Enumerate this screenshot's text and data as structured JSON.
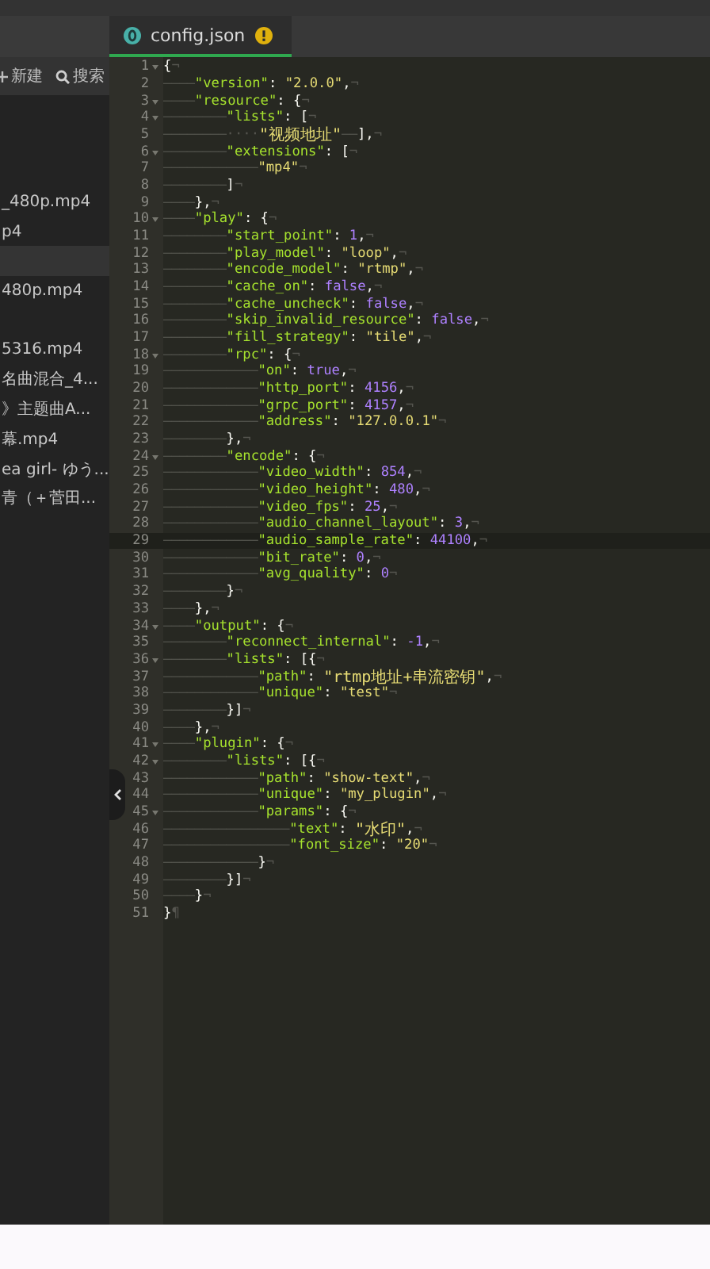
{
  "sidebar": {
    "toolbar": [
      {
        "kind": "new",
        "label": "新建"
      },
      {
        "kind": "search",
        "label": "搜索"
      }
    ],
    "files": [
      {
        "label": "_480p.mp4",
        "selected": false
      },
      {
        "label": "p4",
        "selected": false
      },
      {
        "selected": true
      },
      {
        "label": "480p.mp4",
        "selected": false
      },
      {
        "label": "5316.mp4",
        "selected": false
      },
      {
        "label": "名曲混合_4...",
        "selected": false
      },
      {
        "label": "》主题曲A...",
        "selected": false
      },
      {
        "label": "幕.mp4",
        "selected": false
      },
      {
        "label": "ea girl- ゆう...",
        "selected": false
      },
      {
        "label": "青（＋菅田...",
        "selected": false
      }
    ]
  },
  "tabs": [
    {
      "label": "config.json",
      "selected": true,
      "warning": true
    }
  ],
  "editor": {
    "lines": [
      {
        "n": "1",
        "fold": true,
        "current": false,
        "tokens": [
          {
            "kind": "punct",
            "text": "{"
          },
          {
            "kind": "eol",
            "text": "¬"
          }
        ]
      },
      {
        "n": "2",
        "fold": false,
        "current": false,
        "indent": "————",
        "tokens": [
          {
            "kind": "key",
            "text": "\"version\""
          },
          {
            "kind": "punct",
            "text": ": "
          },
          {
            "kind": "str",
            "text": "\"2.0.0\""
          },
          {
            "kind": "punct",
            "text": ","
          },
          {
            "kind": "eol",
            "text": "¬"
          }
        ]
      },
      {
        "n": "3",
        "fold": true,
        "current": false,
        "indent": "————",
        "tokens": [
          {
            "kind": "key",
            "text": "\"resource\""
          },
          {
            "kind": "punct",
            "text": ": {"
          },
          {
            "kind": "eol",
            "text": "¬"
          }
        ]
      },
      {
        "n": "4",
        "fold": true,
        "current": false,
        "indent": "————————",
        "tokens": [
          {
            "kind": "key",
            "text": "\"lists\""
          },
          {
            "kind": "punct",
            "text": ": ["
          },
          {
            "kind": "eol",
            "text": "¬"
          }
        ]
      },
      {
        "n": "5",
        "fold": false,
        "current": false,
        "indent": "————————",
        "tokens": [
          {
            "kind": "space",
            "text": "····"
          },
          {
            "kind": "str",
            "text": "\"视频地址\""
          },
          {
            "kind": "tab",
            "text": "——"
          },
          {
            "kind": "punct",
            "text": "],"
          },
          {
            "kind": "eol",
            "text": "¬"
          }
        ]
      },
      {
        "n": "6",
        "fold": true,
        "current": false,
        "indent": "————————",
        "tokens": [
          {
            "kind": "key",
            "text": "\"extensions\""
          },
          {
            "kind": "punct",
            "text": ": ["
          },
          {
            "kind": "eol",
            "text": "¬"
          }
        ]
      },
      {
        "n": "7",
        "fold": false,
        "current": false,
        "indent": "————————————",
        "tokens": [
          {
            "kind": "str",
            "text": "\"mp4\""
          },
          {
            "kind": "eol",
            "text": "¬"
          }
        ]
      },
      {
        "n": "8",
        "fold": false,
        "current": false,
        "indent": "————————",
        "tokens": [
          {
            "kind": "punct",
            "text": "]"
          },
          {
            "kind": "eol",
            "text": "¬"
          }
        ]
      },
      {
        "n": "9",
        "fold": false,
        "current": false,
        "indent": "————",
        "tokens": [
          {
            "kind": "punct",
            "text": "},"
          },
          {
            "kind": "eol",
            "text": "¬"
          }
        ]
      },
      {
        "n": "10",
        "fold": true,
        "current": false,
        "indent": "————",
        "tokens": [
          {
            "kind": "key",
            "text": "\"play\""
          },
          {
            "kind": "punct",
            "text": ": {"
          },
          {
            "kind": "eol",
            "text": "¬"
          }
        ]
      },
      {
        "n": "11",
        "fold": false,
        "current": false,
        "indent": "————————",
        "tokens": [
          {
            "kind": "key",
            "text": "\"start_point\""
          },
          {
            "kind": "punct",
            "text": ": "
          },
          {
            "kind": "num",
            "text": "1"
          },
          {
            "kind": "punct",
            "text": ","
          },
          {
            "kind": "eol",
            "text": "¬"
          }
        ]
      },
      {
        "n": "12",
        "fold": false,
        "current": false,
        "indent": "————————",
        "tokens": [
          {
            "kind": "key",
            "text": "\"play_model\""
          },
          {
            "kind": "punct",
            "text": ": "
          },
          {
            "kind": "str",
            "text": "\"loop\""
          },
          {
            "kind": "punct",
            "text": ","
          },
          {
            "kind": "eol",
            "text": "¬"
          }
        ]
      },
      {
        "n": "13",
        "fold": false,
        "current": false,
        "indent": "————————",
        "tokens": [
          {
            "kind": "key",
            "text": "\"encode_model\""
          },
          {
            "kind": "punct",
            "text": ": "
          },
          {
            "kind": "str",
            "text": "\"rtmp\""
          },
          {
            "kind": "punct",
            "text": ","
          },
          {
            "kind": "eol",
            "text": "¬"
          }
        ]
      },
      {
        "n": "14",
        "fold": false,
        "current": false,
        "indent": "————————",
        "tokens": [
          {
            "kind": "key",
            "text": "\"cache_on\""
          },
          {
            "kind": "punct",
            "text": ": "
          },
          {
            "kind": "num",
            "text": "false"
          },
          {
            "kind": "punct",
            "text": ","
          },
          {
            "kind": "eol",
            "text": "¬"
          }
        ]
      },
      {
        "n": "15",
        "fold": false,
        "current": false,
        "indent": "————————",
        "tokens": [
          {
            "kind": "key",
            "text": "\"cache_uncheck\""
          },
          {
            "kind": "punct",
            "text": ": "
          },
          {
            "kind": "num",
            "text": "false"
          },
          {
            "kind": "punct",
            "text": ","
          },
          {
            "kind": "eol",
            "text": "¬"
          }
        ]
      },
      {
        "n": "16",
        "fold": false,
        "current": false,
        "indent": "————————",
        "tokens": [
          {
            "kind": "key",
            "text": "\"skip_invalid_resource\""
          },
          {
            "kind": "punct",
            "text": ": "
          },
          {
            "kind": "num",
            "text": "false"
          },
          {
            "kind": "punct",
            "text": ","
          },
          {
            "kind": "eol",
            "text": "¬"
          }
        ]
      },
      {
        "n": "17",
        "fold": false,
        "current": false,
        "indent": "————————",
        "tokens": [
          {
            "kind": "key",
            "text": "\"fill_strategy\""
          },
          {
            "kind": "punct",
            "text": ": "
          },
          {
            "kind": "str",
            "text": "\"tile\""
          },
          {
            "kind": "punct",
            "text": ","
          },
          {
            "kind": "eol",
            "text": "¬"
          }
        ]
      },
      {
        "n": "18",
        "fold": true,
        "current": false,
        "indent": "————————",
        "tokens": [
          {
            "kind": "key",
            "text": "\"rpc\""
          },
          {
            "kind": "punct",
            "text": ": {"
          },
          {
            "kind": "eol",
            "text": "¬"
          }
        ]
      },
      {
        "n": "19",
        "fold": false,
        "current": false,
        "indent": "————————————",
        "tokens": [
          {
            "kind": "key",
            "text": "\"on\""
          },
          {
            "kind": "punct",
            "text": ": "
          },
          {
            "kind": "num",
            "text": "true"
          },
          {
            "kind": "punct",
            "text": ","
          },
          {
            "kind": "eol",
            "text": "¬"
          }
        ]
      },
      {
        "n": "20",
        "fold": false,
        "current": false,
        "indent": "————————————",
        "tokens": [
          {
            "kind": "key",
            "text": "\"http_port\""
          },
          {
            "kind": "punct",
            "text": ": "
          },
          {
            "kind": "num",
            "text": "4156"
          },
          {
            "kind": "punct",
            "text": ","
          },
          {
            "kind": "eol",
            "text": "¬"
          }
        ]
      },
      {
        "n": "21",
        "fold": false,
        "current": false,
        "indent": "————————————",
        "tokens": [
          {
            "kind": "key",
            "text": "\"grpc_port\""
          },
          {
            "kind": "punct",
            "text": ": "
          },
          {
            "kind": "num",
            "text": "4157"
          },
          {
            "kind": "punct",
            "text": ","
          },
          {
            "kind": "eol",
            "text": "¬"
          }
        ]
      },
      {
        "n": "22",
        "fold": false,
        "current": false,
        "indent": "————————————",
        "tokens": [
          {
            "kind": "key",
            "text": "\"address\""
          },
          {
            "kind": "punct",
            "text": ": "
          },
          {
            "kind": "str",
            "text": "\"127.0.0.1\""
          },
          {
            "kind": "eol",
            "text": "¬"
          }
        ]
      },
      {
        "n": "23",
        "fold": false,
        "current": false,
        "indent": "————————",
        "tokens": [
          {
            "kind": "punct",
            "text": "},"
          },
          {
            "kind": "eol",
            "text": "¬"
          }
        ]
      },
      {
        "n": "24",
        "fold": true,
        "current": false,
        "indent": "————————",
        "tokens": [
          {
            "kind": "key",
            "text": "\"encode\""
          },
          {
            "kind": "punct",
            "text": ": {"
          },
          {
            "kind": "eol",
            "text": "¬"
          }
        ]
      },
      {
        "n": "25",
        "fold": false,
        "current": false,
        "indent": "————————————",
        "tokens": [
          {
            "kind": "key",
            "text": "\"video_width\""
          },
          {
            "kind": "punct",
            "text": ": "
          },
          {
            "kind": "num",
            "text": "854"
          },
          {
            "kind": "punct",
            "text": ","
          },
          {
            "kind": "eol",
            "text": "¬"
          }
        ]
      },
      {
        "n": "26",
        "fold": false,
        "current": false,
        "indent": "————————————",
        "tokens": [
          {
            "kind": "key",
            "text": "\"video_height\""
          },
          {
            "kind": "punct",
            "text": ": "
          },
          {
            "kind": "num",
            "text": "480"
          },
          {
            "kind": "punct",
            "text": ","
          },
          {
            "kind": "eol",
            "text": "¬"
          }
        ]
      },
      {
        "n": "27",
        "fold": false,
        "current": false,
        "indent": "————————————",
        "tokens": [
          {
            "kind": "key",
            "text": "\"video_fps\""
          },
          {
            "kind": "punct",
            "text": ": "
          },
          {
            "kind": "num",
            "text": "25"
          },
          {
            "kind": "punct",
            "text": ","
          },
          {
            "kind": "eol",
            "text": "¬"
          }
        ]
      },
      {
        "n": "28",
        "fold": false,
        "current": false,
        "indent": "————————————",
        "tokens": [
          {
            "kind": "key",
            "text": "\"audio_channel_layout\""
          },
          {
            "kind": "punct",
            "text": ": "
          },
          {
            "kind": "num",
            "text": "3"
          },
          {
            "kind": "punct",
            "text": ","
          },
          {
            "kind": "eol",
            "text": "¬"
          }
        ]
      },
      {
        "n": "29",
        "fold": false,
        "current": true,
        "indent": "————————————",
        "tokens": [
          {
            "kind": "key",
            "text": "\"audio_sample_rate\""
          },
          {
            "kind": "punct",
            "text": ": "
          },
          {
            "kind": "num",
            "text": "44100"
          },
          {
            "kind": "punct",
            "text": ","
          },
          {
            "kind": "eol",
            "text": "¬"
          }
        ]
      },
      {
        "n": "30",
        "fold": false,
        "current": false,
        "indent": "————————————",
        "tokens": [
          {
            "kind": "key",
            "text": "\"bit_rate\""
          },
          {
            "kind": "punct",
            "text": ": "
          },
          {
            "kind": "num",
            "text": "0"
          },
          {
            "kind": "punct",
            "text": ","
          },
          {
            "kind": "eol",
            "text": "¬"
          }
        ]
      },
      {
        "n": "31",
        "fold": false,
        "current": false,
        "indent": "————————————",
        "tokens": [
          {
            "kind": "key",
            "text": "\"avg_quality\""
          },
          {
            "kind": "punct",
            "text": ": "
          },
          {
            "kind": "num",
            "text": "0"
          },
          {
            "kind": "eol",
            "text": "¬"
          }
        ]
      },
      {
        "n": "32",
        "fold": false,
        "current": false,
        "indent": "————————",
        "tokens": [
          {
            "kind": "punct",
            "text": "}"
          },
          {
            "kind": "eol",
            "text": "¬"
          }
        ]
      },
      {
        "n": "33",
        "fold": false,
        "current": false,
        "indent": "————",
        "tokens": [
          {
            "kind": "punct",
            "text": "},"
          },
          {
            "kind": "eol",
            "text": "¬"
          }
        ]
      },
      {
        "n": "34",
        "fold": true,
        "current": false,
        "indent": "————",
        "tokens": [
          {
            "kind": "key",
            "text": "\"output\""
          },
          {
            "kind": "punct",
            "text": ": {"
          },
          {
            "kind": "eol",
            "text": "¬"
          }
        ]
      },
      {
        "n": "35",
        "fold": false,
        "current": false,
        "indent": "————————",
        "tokens": [
          {
            "kind": "key",
            "text": "\"reconnect_internal\""
          },
          {
            "kind": "punct",
            "text": ": "
          },
          {
            "kind": "num",
            "text": "-1"
          },
          {
            "kind": "punct",
            "text": ","
          },
          {
            "kind": "eol",
            "text": "¬"
          }
        ]
      },
      {
        "n": "36",
        "fold": true,
        "current": false,
        "indent": "————————",
        "tokens": [
          {
            "kind": "key",
            "text": "\"lists\""
          },
          {
            "kind": "punct",
            "text": ": [{"
          },
          {
            "kind": "eol",
            "text": "¬"
          }
        ]
      },
      {
        "n": "37",
        "fold": false,
        "current": false,
        "indent": "————————————",
        "tokens": [
          {
            "kind": "key",
            "text": "\"path\""
          },
          {
            "kind": "punct",
            "text": ": "
          },
          {
            "kind": "str",
            "text": "\"rtmp地址+串流密钥\""
          },
          {
            "kind": "punct",
            "text": ","
          },
          {
            "kind": "eol",
            "text": "¬"
          }
        ]
      },
      {
        "n": "38",
        "fold": false,
        "current": false,
        "indent": "————————————",
        "tokens": [
          {
            "kind": "key",
            "text": "\"unique\""
          },
          {
            "kind": "punct",
            "text": ": "
          },
          {
            "kind": "str",
            "text": "\"test\""
          },
          {
            "kind": "eol",
            "text": "¬"
          }
        ]
      },
      {
        "n": "39",
        "fold": false,
        "current": false,
        "indent": "————————",
        "tokens": [
          {
            "kind": "punct",
            "text": "}]"
          },
          {
            "kind": "eol",
            "text": "¬"
          }
        ]
      },
      {
        "n": "40",
        "fold": false,
        "current": false,
        "indent": "————",
        "tokens": [
          {
            "kind": "punct",
            "text": "},"
          },
          {
            "kind": "eol",
            "text": "¬"
          }
        ]
      },
      {
        "n": "41",
        "fold": true,
        "current": false,
        "indent": "————",
        "tokens": [
          {
            "kind": "key",
            "text": "\"plugin\""
          },
          {
            "kind": "punct",
            "text": ": {"
          },
          {
            "kind": "eol",
            "text": "¬"
          }
        ]
      },
      {
        "n": "42",
        "fold": true,
        "current": false,
        "indent": "————————",
        "tokens": [
          {
            "kind": "key",
            "text": "\"lists\""
          },
          {
            "kind": "punct",
            "text": ": [{"
          },
          {
            "kind": "eol",
            "text": "¬"
          }
        ]
      },
      {
        "n": "43",
        "fold": false,
        "current": false,
        "indent": "————————————",
        "tokens": [
          {
            "kind": "key",
            "text": "\"path\""
          },
          {
            "kind": "punct",
            "text": ": "
          },
          {
            "kind": "str",
            "text": "\"show-text\""
          },
          {
            "kind": "punct",
            "text": ","
          },
          {
            "kind": "eol",
            "text": "¬"
          }
        ]
      },
      {
        "n": "44",
        "fold": false,
        "current": false,
        "indent": "————————————",
        "tokens": [
          {
            "kind": "key",
            "text": "\"unique\""
          },
          {
            "kind": "punct",
            "text": ": "
          },
          {
            "kind": "str",
            "text": "\"my_plugin\""
          },
          {
            "kind": "punct",
            "text": ","
          },
          {
            "kind": "eol",
            "text": "¬"
          }
        ]
      },
      {
        "n": "45",
        "fold": true,
        "current": false,
        "indent": "————————————",
        "tokens": [
          {
            "kind": "key",
            "text": "\"params\""
          },
          {
            "kind": "punct",
            "text": ": {"
          },
          {
            "kind": "eol",
            "text": "¬"
          }
        ]
      },
      {
        "n": "46",
        "fold": false,
        "current": false,
        "indent": "————————————————",
        "tokens": [
          {
            "kind": "key",
            "text": "\"text\""
          },
          {
            "kind": "punct",
            "text": ": "
          },
          {
            "kind": "str",
            "text": "\"水印\""
          },
          {
            "kind": "punct",
            "text": ","
          },
          {
            "kind": "eol",
            "text": "¬"
          }
        ]
      },
      {
        "n": "47",
        "fold": false,
        "current": false,
        "indent": "————————————————",
        "tokens": [
          {
            "kind": "key",
            "text": "\"font_size\""
          },
          {
            "kind": "punct",
            "text": ": "
          },
          {
            "kind": "str",
            "text": "\"20\""
          },
          {
            "kind": "eol",
            "text": "¬"
          }
        ]
      },
      {
        "n": "48",
        "fold": false,
        "current": false,
        "indent": "————————————",
        "tokens": [
          {
            "kind": "punct",
            "text": "}"
          },
          {
            "kind": "eol",
            "text": "¬"
          }
        ]
      },
      {
        "n": "49",
        "fold": false,
        "current": false,
        "indent": "————————",
        "tokens": [
          {
            "kind": "punct",
            "text": "}]"
          },
          {
            "kind": "eol",
            "text": "¬"
          }
        ]
      },
      {
        "n": "50",
        "fold": false,
        "current": false,
        "indent": "————",
        "tokens": [
          {
            "kind": "punct",
            "text": "}"
          },
          {
            "kind": "eol",
            "text": "¬"
          }
        ]
      },
      {
        "n": "51",
        "fold": false,
        "current": false,
        "tokens": [
          {
            "kind": "punct",
            "text": "}"
          },
          {
            "kind": "eol",
            "text": "¶"
          }
        ]
      }
    ]
  }
}
